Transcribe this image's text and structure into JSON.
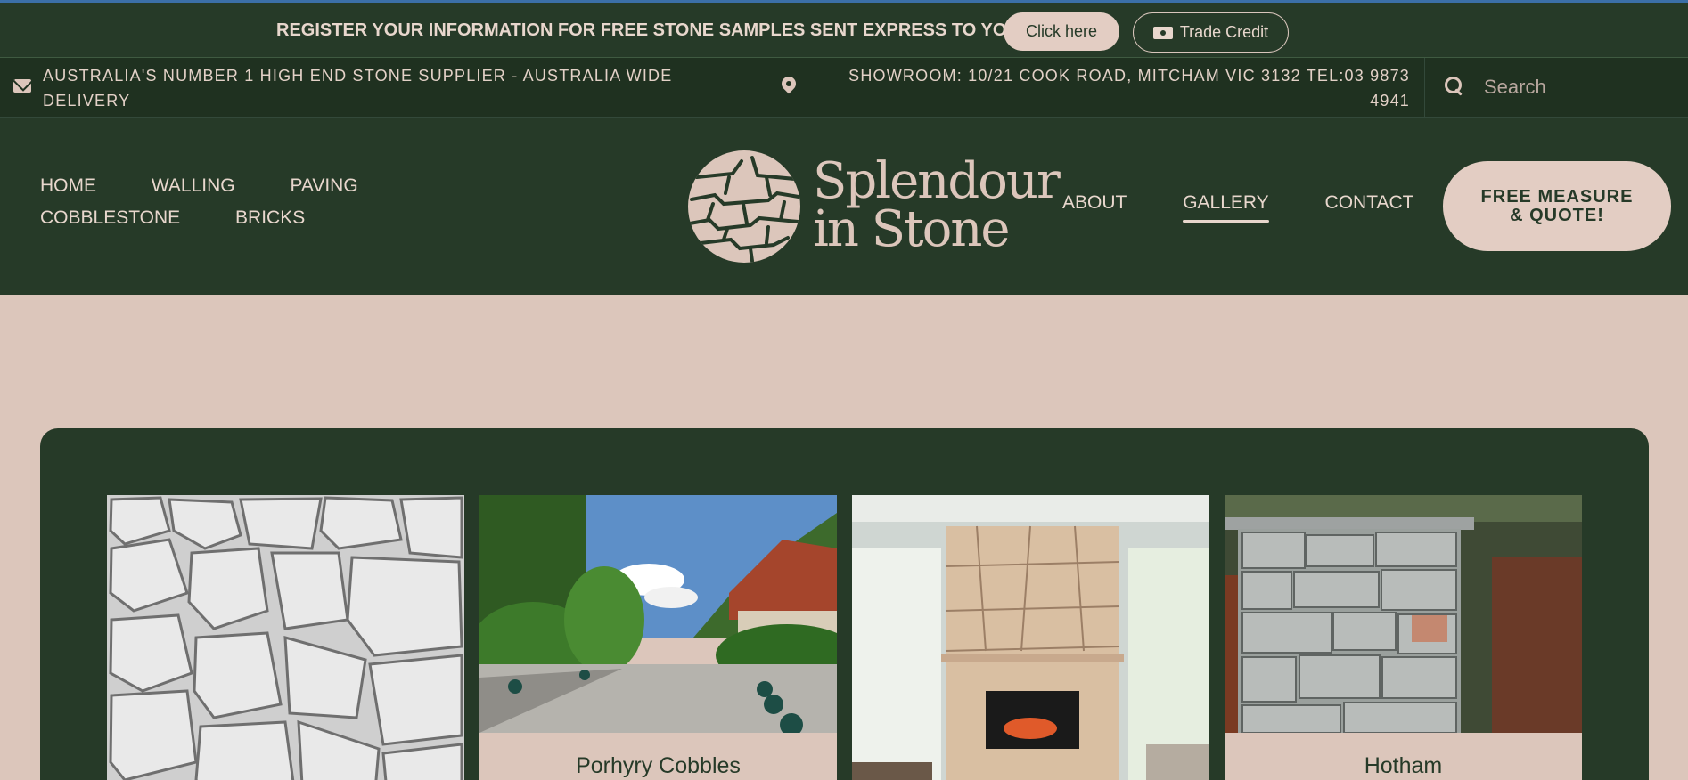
{
  "promo": {
    "text": "REGISTER YOUR INFORMATION FOR FREE STONE SAMPLES SENT EXPRESS TO YOU!",
    "click_label": "Click here",
    "trade_label": "Trade Credit",
    "trade_icon": "cash-icon"
  },
  "info": {
    "left_text": "AUSTRALIA'S NUMBER 1 HIGH END STONE SUPPLIER - AUSTRALIA WIDE DELIVERY",
    "right_text": "SHOWROOM: 10/21 COOK ROAD, MITCHAM VIC 3132 TEL:03 9873 4941",
    "search_placeholder": "Search"
  },
  "nav": {
    "left": [
      "HOME",
      "WALLING",
      "PAVING",
      "COBBLESTONE",
      "BRICKS"
    ],
    "right": [
      "ABOUT",
      "GALLERY",
      "CONTACT"
    ],
    "active": "GALLERY",
    "cta": "FREE MEASURE & QUOTE!"
  },
  "logo": {
    "line1": "Splendour",
    "line2": "in Stone"
  },
  "gallery": {
    "cards": [
      {
        "caption": ""
      },
      {
        "caption": "Porhyry Cobbles"
      },
      {
        "caption": ""
      },
      {
        "caption": "Hotham"
      }
    ]
  },
  "colors": {
    "dark_green": "#263a28",
    "darker_green": "#1f3120",
    "blush": "#dcc6bb",
    "button_blush": "#e3cdc3"
  }
}
